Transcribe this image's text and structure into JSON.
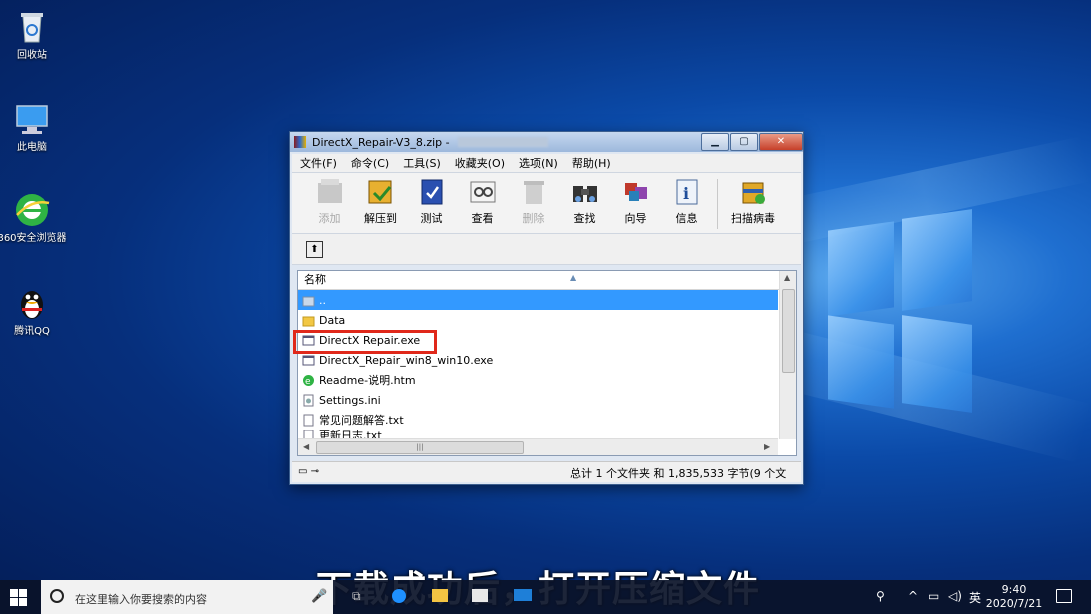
{
  "desktop": {
    "icons": [
      {
        "label": "回收站"
      },
      {
        "label": "此电脑"
      },
      {
        "label": "360安全浏览器"
      },
      {
        "label": "腾讯QQ"
      }
    ]
  },
  "window": {
    "title": "DirectX_Repair-V3_8.zip -",
    "controls": {
      "minimize": "▁",
      "maximize": "▢",
      "close": "✕"
    },
    "menu": [
      "文件(F)",
      "命令(C)",
      "工具(S)",
      "收藏夹(O)",
      "选项(N)",
      "帮助(H)"
    ],
    "toolbar": [
      {
        "label": "添加",
        "icon": "add-icon",
        "enabled": false
      },
      {
        "label": "解压到",
        "icon": "extract-icon",
        "enabled": true
      },
      {
        "label": "测试",
        "icon": "test-icon",
        "enabled": true
      },
      {
        "label": "查看",
        "icon": "view-icon",
        "enabled": true
      },
      {
        "label": "删除",
        "icon": "delete-icon",
        "enabled": false
      },
      {
        "label": "查找",
        "icon": "find-icon",
        "enabled": true
      },
      {
        "label": "向导",
        "icon": "wizard-icon",
        "enabled": true
      },
      {
        "label": "信息",
        "icon": "info-icon",
        "enabled": true
      },
      {
        "label": "扫描病毒",
        "icon": "virus-scan-icon",
        "enabled": true
      }
    ],
    "column_header": "名称",
    "files": [
      {
        "name": "..",
        "type": "up-folder"
      },
      {
        "name": "Data",
        "type": "folder"
      },
      {
        "name": "DirectX Repair.exe",
        "type": "exe"
      },
      {
        "name": "DirectX_Repair_win8_win10.exe",
        "type": "exe"
      },
      {
        "name": "Readme-说明.htm",
        "type": "htm"
      },
      {
        "name": "Settings.ini",
        "type": "ini"
      },
      {
        "name": "常见问题解答.txt",
        "type": "txt"
      },
      {
        "name": "更新日志.txt",
        "type": "txt"
      }
    ],
    "status": "总计 1 个文件夹 和 1,835,533 字节(9 个文"
  },
  "subtitle": "下载成功后，打开压缩文件",
  "taskbar": {
    "search_placeholder": "在这里输入你要搜索的内容",
    "ime": "英",
    "time": "9:40",
    "date": "2020/7/21"
  },
  "colors": {
    "highlight_box": "#e0281a",
    "selection": "#3399ff"
  }
}
